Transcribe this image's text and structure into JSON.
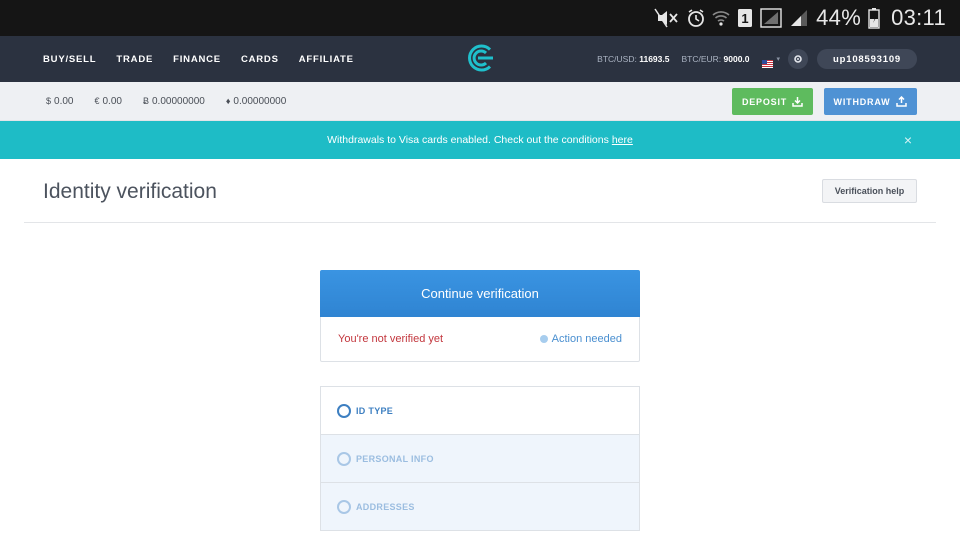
{
  "status_bar": {
    "battery_percent": "44%",
    "time": "03:11",
    "icons": [
      "mute-icon",
      "alarm-icon",
      "wifi-icon",
      "sim-1-icon",
      "signal-icon",
      "signal-icon",
      "battery-charging-icon"
    ],
    "sim_label": "1"
  },
  "nav": {
    "links": [
      "BUY/SELL",
      "TRADE",
      "FINANCE",
      "CARDS",
      "AFFILIATE"
    ],
    "logo": "cex-logo-icon",
    "rates": [
      {
        "label": "BTC/USD:",
        "value": "11693.5"
      },
      {
        "label": "BTC/EUR:",
        "value": "9000.0"
      }
    ],
    "user_id": "up108593109"
  },
  "balances": [
    {
      "symbol": "$",
      "value": "0.00"
    },
    {
      "symbol": "€",
      "value": "0.00"
    },
    {
      "symbol": "Ƀ",
      "value": "0.00000000"
    },
    {
      "symbol": "♦",
      "value": "0.00000000"
    }
  ],
  "actions": {
    "deposit": "DEPOSIT",
    "withdraw": "WITHDRAW"
  },
  "notice": {
    "text": "Withdrawals to Visa cards enabled. Check out the conditions",
    "link": "here",
    "close": "×"
  },
  "page": {
    "title": "Identity verification",
    "help_button": "Verification help"
  },
  "verification": {
    "continue_label": "Continue verification",
    "status_text": "You're not verified yet",
    "action_text": "Action needed"
  },
  "steps": [
    {
      "label": "ID TYPE",
      "state": "active"
    },
    {
      "label": "PERSONAL INFO",
      "state": "inactive"
    },
    {
      "label": "ADDRESSES",
      "state": "inactive"
    }
  ],
  "colors": {
    "nav_bg": "#2b3240",
    "accent_teal": "#1ebcc6",
    "deposit_green": "#5ebb5e",
    "withdraw_blue": "#4f92d4",
    "continue_blue": "#3a94e2",
    "error_red": "#c3373e"
  }
}
